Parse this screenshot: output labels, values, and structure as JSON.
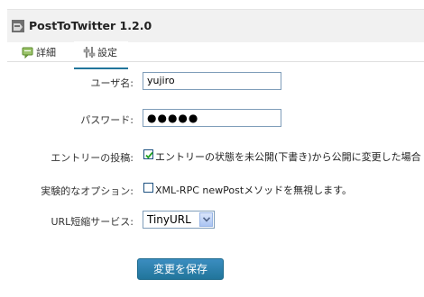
{
  "header": {
    "title": "PostToTwitter 1.2.0"
  },
  "tabs": [
    {
      "label": "詳細"
    },
    {
      "label": "設定"
    }
  ],
  "form": {
    "username_label": "ユーザ名:",
    "username_value": "yujiro",
    "password_label": "パスワード:",
    "password_value": "●●●●●",
    "entry_post_label": "エントリーの投稿:",
    "entry_post_checked": true,
    "entry_post_text": "エントリーの状態を未公開(下書き)から公開に変更した場合",
    "experimental_label": "実験的なオプション:",
    "experimental_checked": false,
    "experimental_text": "XML-RPC newPostメソッドを無視します。",
    "url_service_label": "URL短縮サービス:",
    "url_service_value": "TinyURL"
  },
  "save_button_label": "変更を保存",
  "colors": {
    "accent": "#21759b",
    "titlebar_bg": "#f1f1f1",
    "input_border": "#7f9db9"
  }
}
